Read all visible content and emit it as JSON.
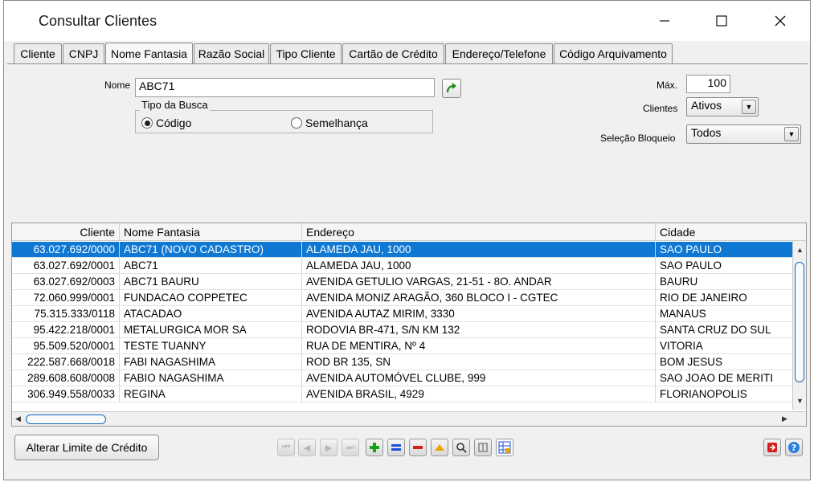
{
  "window": {
    "title": "Consultar Clientes"
  },
  "tabs": [
    {
      "label": "Cliente"
    },
    {
      "label": "CNPJ"
    },
    {
      "label": "Nome Fantasia"
    },
    {
      "label": "Razão Social"
    },
    {
      "label": "Tipo Cliente"
    },
    {
      "label": "Cartão de Crédito"
    },
    {
      "label": "Endereço/Telefone"
    },
    {
      "label": "Código Arquivamento"
    }
  ],
  "form": {
    "nome_label": "Nome",
    "nome_value": "ABC71",
    "tipo_busca_label": "Tipo da Busca",
    "radio_codigo": "Código",
    "radio_semelhanca": "Semelhança",
    "max_label": "Máx.",
    "max_value": "100",
    "clientes_label": "Clientes",
    "clientes_value": "Ativos",
    "selecao_label": "Seleção Bloqueio",
    "selecao_value": "Todos"
  },
  "grid": {
    "columns": [
      "Cliente",
      "Nome Fantasia",
      "Endereço",
      "Cidade"
    ],
    "rows": [
      [
        "63.027.692/0000",
        "ABC71 (NOVO CADASTRO)",
        "ALAMEDA JAU, 1000",
        "SAO PAULO"
      ],
      [
        "63.027.692/0001",
        "ABC71",
        "ALAMEDA JAU, 1000",
        "SAO PAULO"
      ],
      [
        "63.027.692/0003",
        "ABC71 BAURU",
        "AVENIDA GETULIO VARGAS, 21-51 - 8O. ANDAR",
        "BAURU"
      ],
      [
        "72.060.999/0001",
        "FUNDACAO COPPETEC",
        "AVENIDA MONIZ ARAGÃO, 360 BLOCO I - CGTEC",
        "RIO DE JANEIRO"
      ],
      [
        "75.315.333/0118",
        "ATACADAO",
        "AVENIDA AUTAZ MIRIM, 3330",
        "MANAUS"
      ],
      [
        "95.422.218/0001",
        "METALURGICA MOR SA",
        "RODOVIA BR-471, S/N KM 132",
        "SANTA CRUZ DO SUL"
      ],
      [
        "95.509.520/0001",
        "TESTE TUANNY",
        "RUA DE MENTIRA, Nº 4",
        "VITORIA"
      ],
      [
        "222.587.668/0018",
        "FABI NAGASHIMA",
        "ROD BR 135, SN",
        "BOM JESUS"
      ],
      [
        "289.608.608/0008",
        "FABIO NAGASHIMA",
        "AVENIDA AUTOMÓVEL CLUBE, 999",
        "SAO JOAO DE MERITI"
      ],
      [
        "306.949.558/0033",
        "REGINA",
        "AVENIDA BRASIL, 4929",
        "FLORIANOPOLIS"
      ]
    ]
  },
  "bottom": {
    "alterar_label": "Alterar Limite de Crédito"
  },
  "icons": {
    "first": "first-record-icon",
    "prev": "previous-record-icon",
    "next": "next-record-icon",
    "last": "last-record-icon",
    "add": "add-icon",
    "equal": "equal-icon",
    "remove": "remove-icon",
    "up": "up-icon",
    "search": "search-icon",
    "columns": "columns-icon",
    "grid": "grid-icon",
    "exit": "exit-icon",
    "help": "help-icon"
  },
  "colors": {
    "selection": "#0e78d2",
    "add": "#16a316",
    "remove": "#d62020",
    "equal": "#1f4fd6",
    "help": "#2a7de1",
    "exit": "#d62020"
  }
}
